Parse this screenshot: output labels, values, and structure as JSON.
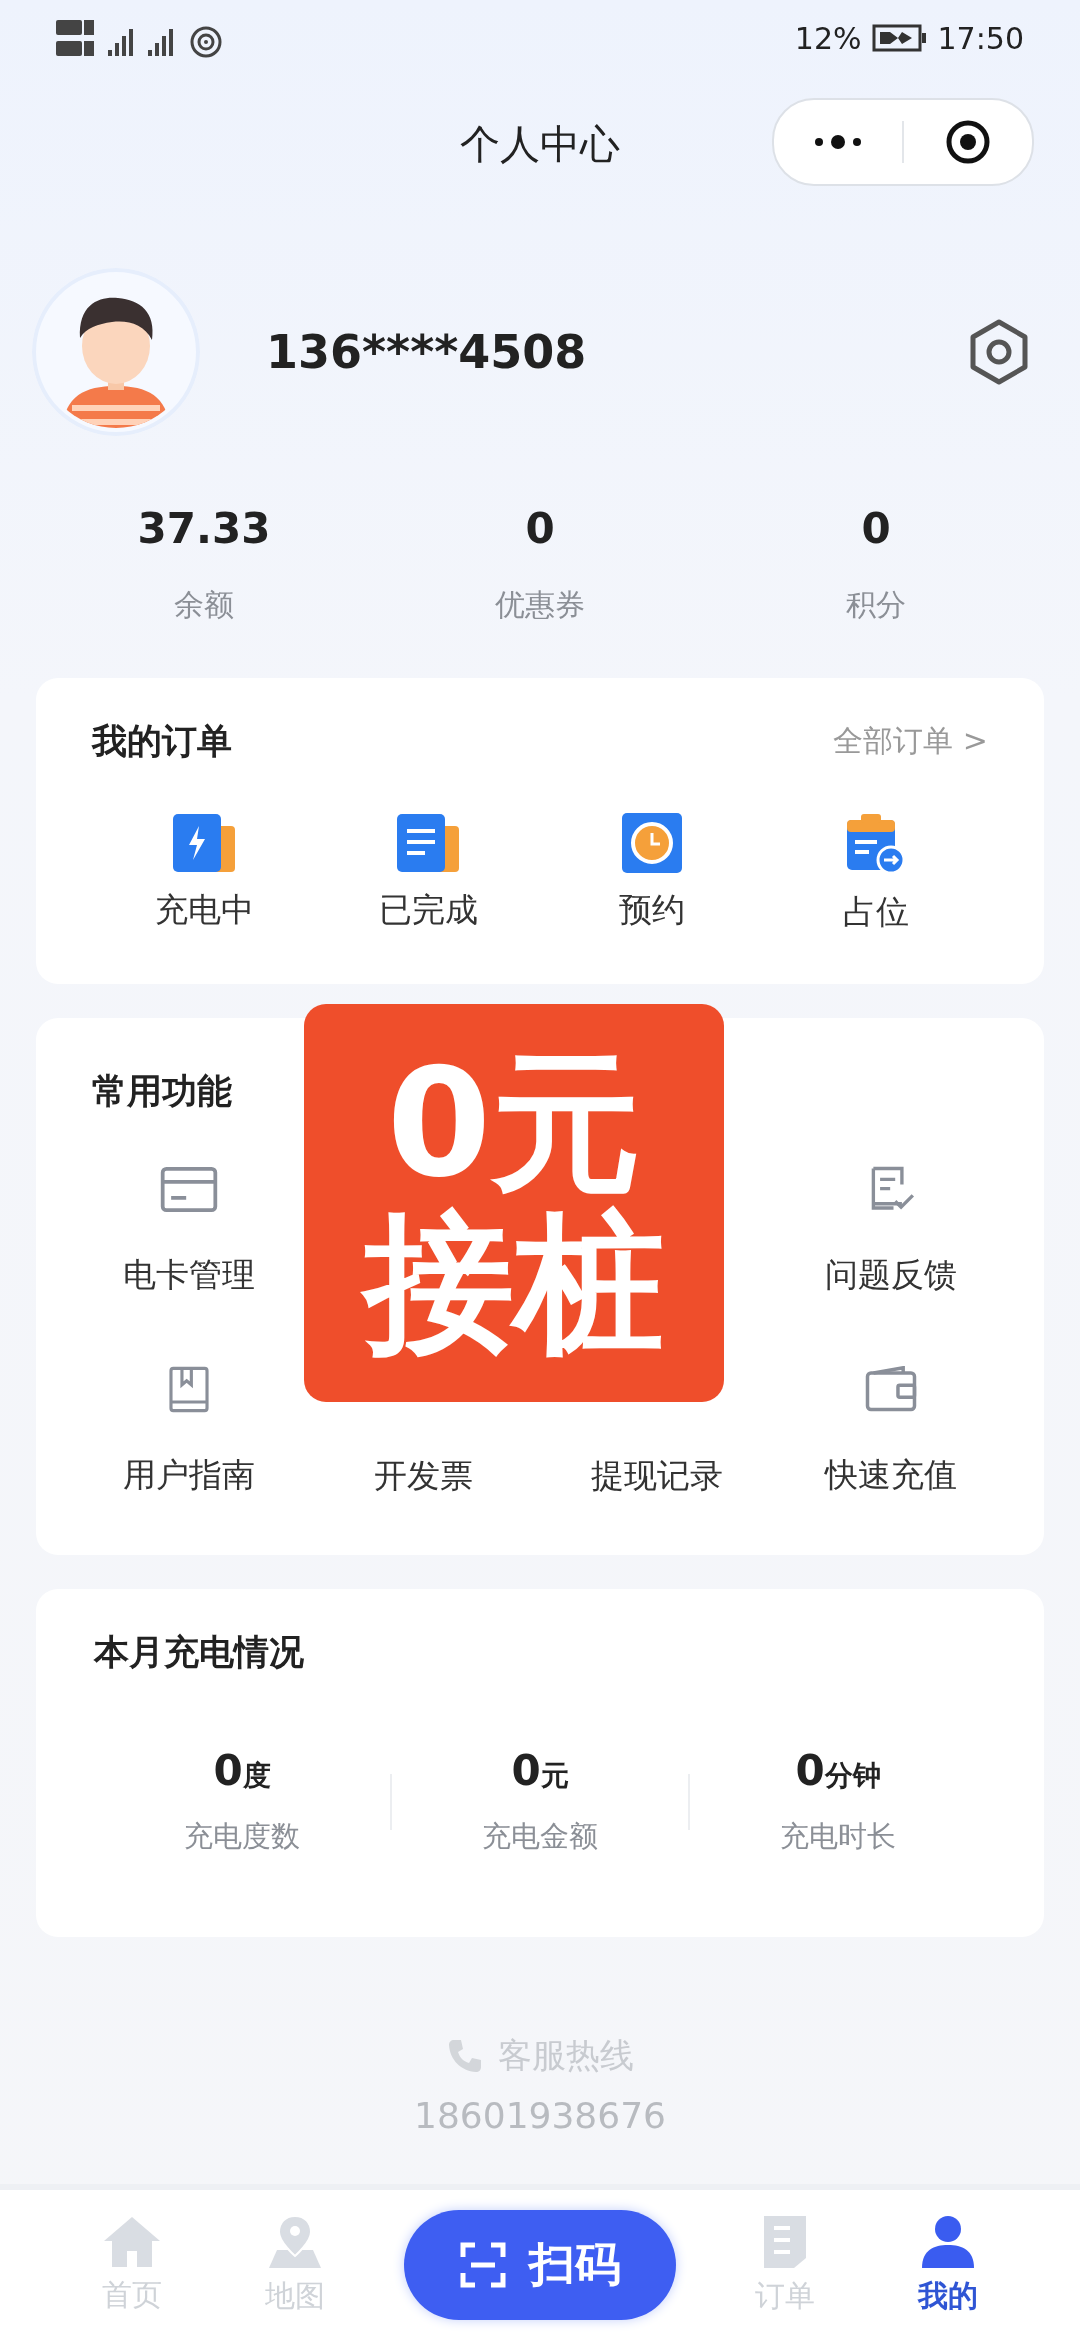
{
  "status_bar": {
    "battery": "12%",
    "time": "17:50"
  },
  "header": {
    "title": "个人中心"
  },
  "profile": {
    "phone": "136****4508"
  },
  "stats": [
    {
      "value": "37.33",
      "label": "余额"
    },
    {
      "value": "0",
      "label": "优惠券"
    },
    {
      "value": "0",
      "label": "积分"
    }
  ],
  "orders": {
    "title": "我的订单",
    "link": "全部订单 >",
    "items": [
      {
        "label": "充电中",
        "kind": "charging"
      },
      {
        "label": "已完成",
        "kind": "done"
      },
      {
        "label": "预约",
        "kind": "reserve"
      },
      {
        "label": "占位",
        "kind": "occupy"
      }
    ]
  },
  "functions": {
    "title": "常用功能",
    "items": [
      {
        "label": "电卡管理",
        "kind": "card"
      },
      {
        "kind": "covered"
      },
      {
        "kind": "covered"
      },
      {
        "label": "问题反馈",
        "kind": "feedback"
      },
      {
        "label": "用户指南",
        "kind": "guide"
      },
      {
        "label": "开发票",
        "kind": "covered-icon"
      },
      {
        "label": "提现记录",
        "kind": "covered-icon"
      },
      {
        "label": "快速充值",
        "kind": "wallet"
      }
    ]
  },
  "promo_sticker": {
    "line1": "0元",
    "line2": "接桩"
  },
  "monthly": {
    "title": "本月充电情况",
    "items": [
      {
        "value": "0",
        "unit": "度",
        "label": "充电度数"
      },
      {
        "value": "0",
        "unit": "元",
        "label": "充电金额"
      },
      {
        "value": "0",
        "unit": "分钟",
        "label": "充电时长"
      }
    ]
  },
  "hotline": {
    "label": "客服热线",
    "number": "18601938676"
  },
  "tab_bar": {
    "items": [
      {
        "label": "首页",
        "kind": "home",
        "selected": false
      },
      {
        "label": "地图",
        "kind": "map",
        "selected": false
      },
      {
        "label": "扫码",
        "kind": "scan",
        "selected": false
      },
      {
        "label": "订单",
        "kind": "order",
        "selected": false
      },
      {
        "label": "我的",
        "kind": "me",
        "selected": true
      }
    ]
  }
}
